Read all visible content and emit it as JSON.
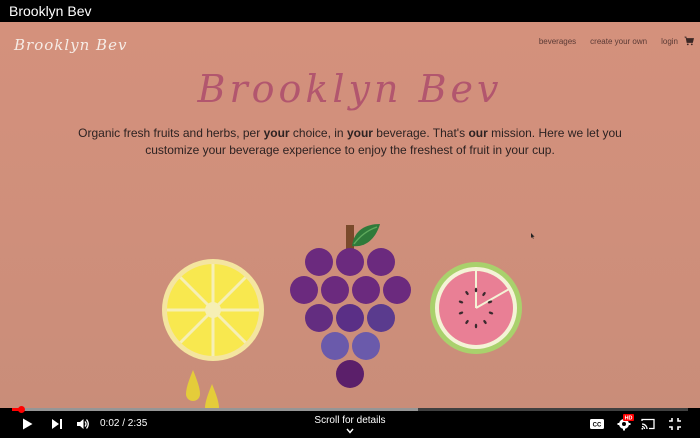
{
  "video": {
    "title": "Brooklyn Bev",
    "current_time": "0:02",
    "duration": "2:35",
    "time_display": "0:02 / 2:35",
    "progress_fraction": 0.013,
    "scroll_hint": "Scroll for details"
  },
  "site": {
    "logo": "Brooklyn Bev",
    "nav": [
      {
        "label": "beverages"
      },
      {
        "label": "create your own"
      },
      {
        "label": "login"
      }
    ],
    "hero_title": "Brooklyn Bev",
    "mission": {
      "p1": "Organic fresh fruits and herbs, per ",
      "b1": "your",
      "p2": " choice, in ",
      "b2": "your",
      "p3": " beverage. That's ",
      "b3": "our",
      "p4": " mission. Here we let you customize your beverage experience to enjoy the freshest of fruit in your cup."
    }
  },
  "controls": {
    "icons": [
      "play-icon",
      "next-icon",
      "volume-icon",
      "captions-icon",
      "settings-icon",
      "cast-icon",
      "fullscreen-exit-icon"
    ],
    "settings_badge": "HD"
  },
  "colors": {
    "background": "#d08f7b",
    "title": "#b2566e",
    "progress": "#ff0000",
    "lemon": "#f7e34f",
    "grape_dark": "#5b1f6a",
    "grape_light": "#6e5fad",
    "watermelon_flesh": "#e97f95",
    "watermelon_rind": "#a9d16c"
  }
}
